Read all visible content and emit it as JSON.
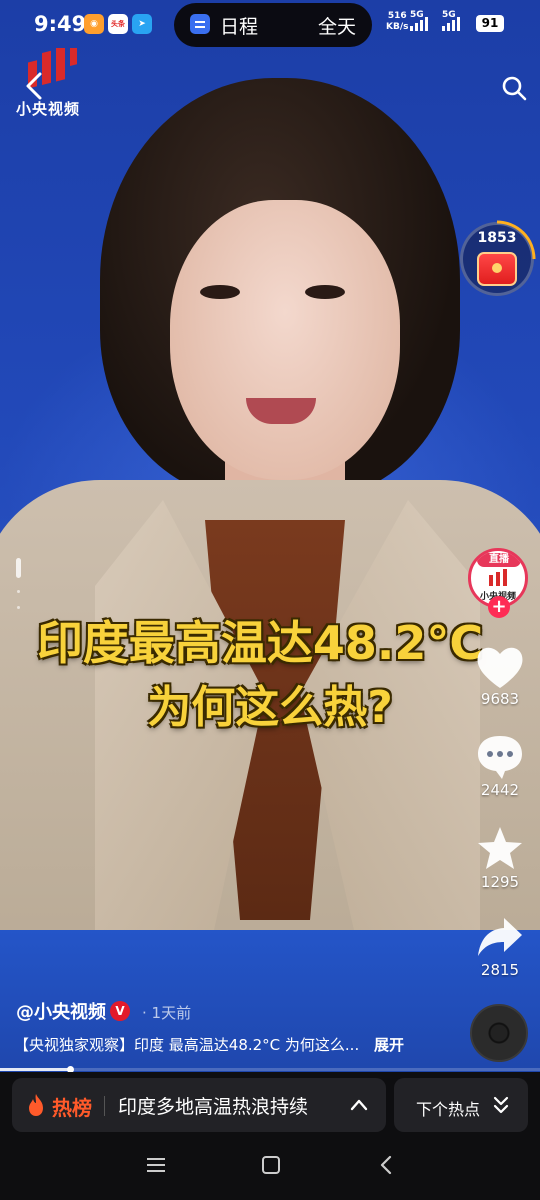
{
  "status_bar": {
    "time": "9:49",
    "app_icons": [
      {
        "name": "orange-app-icon",
        "text": ""
      },
      {
        "name": "toutiao-app-icon",
        "text": "头条"
      },
      {
        "name": "telegram-app-icon",
        "text": ""
      }
    ],
    "island": {
      "title": "日程",
      "right_text": "全天"
    },
    "net_speed_value": "516",
    "net_speed_unit": "KB/s",
    "signal_1_label": "5G",
    "signal_2_label": "5G",
    "battery": "91"
  },
  "channel": {
    "logo_text": "小央视频"
  },
  "red_packet": {
    "count": "1853"
  },
  "caption": {
    "line1": "印度最高温达48.2°C",
    "line2": "为何这么热?"
  },
  "author_avatar": {
    "live_badge": "直播",
    "name": "小央视频"
  },
  "actions": {
    "likes": "9683",
    "comments": "2442",
    "favorites": "1295",
    "shares": "2815"
  },
  "post": {
    "author": "@小央视频",
    "verified": "V",
    "time": "· 1天前",
    "description": "【央视独家观察】印度 最高温达48.2°C 为何这么...",
    "expand": "展开",
    "progress": 0.13
  },
  "hot_bar": {
    "label": "热榜",
    "topic": "印度多地高温热浪持续",
    "next_label": "下个热点"
  },
  "colors": {
    "accent_red": "#fe2c55",
    "caption_yellow": "#f8d23b",
    "hot_orange": "#ff5a2a"
  }
}
